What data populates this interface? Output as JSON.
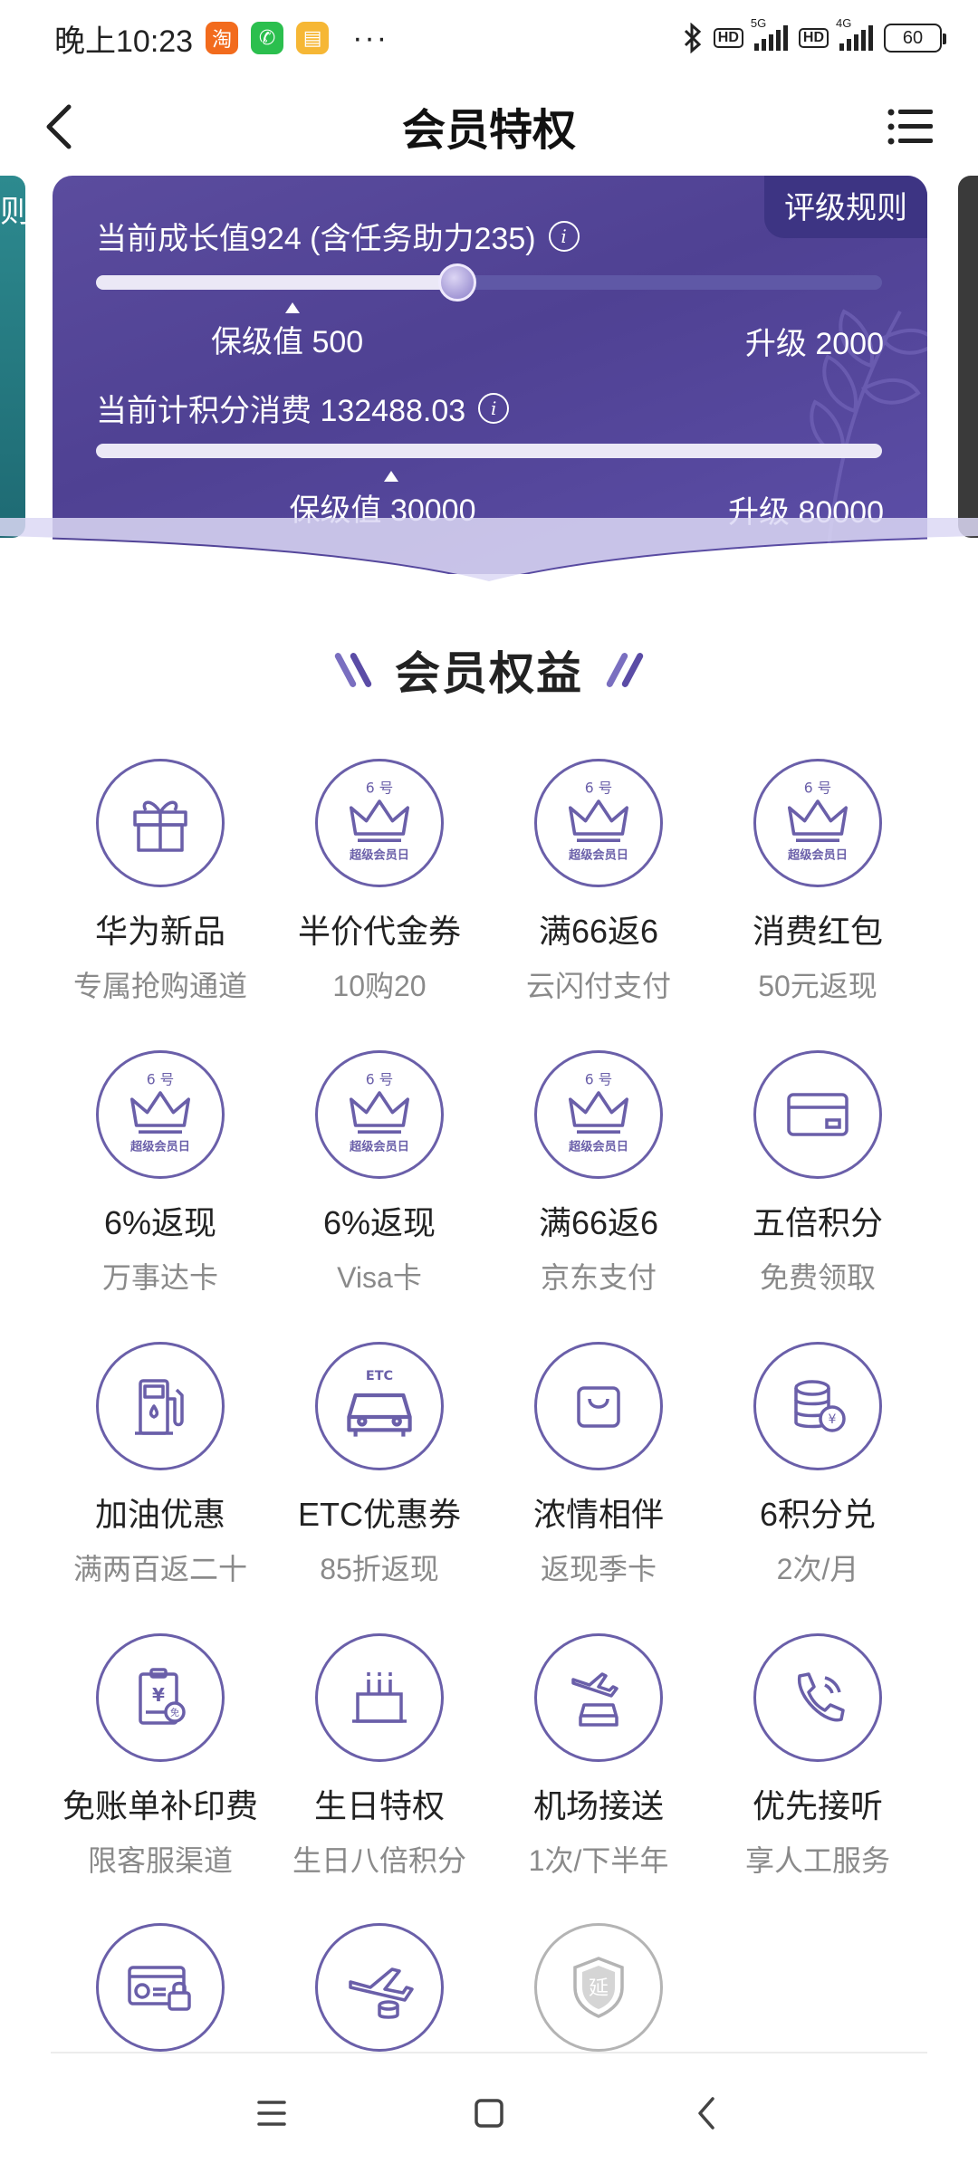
{
  "status_bar": {
    "time": "晚上10:23",
    "app_badges": [
      {
        "glyph": "淘",
        "color": "#f26b1d"
      },
      {
        "glyph": "✆",
        "color": "#2bbf4e"
      },
      {
        "glyph": "▤",
        "color": "#f6b735"
      }
    ],
    "more": "···",
    "hd1": "HD",
    "net1": "5G",
    "hd2": "HD",
    "net2": "4G",
    "battery": "60"
  },
  "header": {
    "title": "会员特权"
  },
  "banner": {
    "side_peek_text": "则",
    "rules_label": "评级规则",
    "growth": {
      "label": "当前成长值924 (含任务助力235)",
      "progress": 0.46,
      "keep_label": "保级值 500",
      "keep_pos": 0.25,
      "upgrade_label": "升级 2000"
    },
    "points": {
      "label": "当前计积分消费 132488.03",
      "progress": 1.0,
      "keep_label": "保级值 30000",
      "keep_pos": 0.375,
      "upgrade_label": "升级 80000"
    }
  },
  "section": {
    "title": "会员权益"
  },
  "benefits": [
    {
      "icon": "gift-icon",
      "name": "华为新品",
      "desc": "专属抢购通道"
    },
    {
      "icon": "super-member-day-icon",
      "name": "半价代金券",
      "desc": "10购20"
    },
    {
      "icon": "super-member-day-icon",
      "name": "满66返6",
      "desc": "云闪付支付"
    },
    {
      "icon": "super-member-day-icon",
      "name": "消费红包",
      "desc": "50元返现"
    },
    {
      "icon": "super-member-day-icon",
      "name": "6%返现",
      "desc": "万事达卡"
    },
    {
      "icon": "super-member-day-icon",
      "name": "6%返现",
      "desc": "Visa卡"
    },
    {
      "icon": "super-member-day-icon",
      "name": "满66返6",
      "desc": "京东支付"
    },
    {
      "icon": "card-icon",
      "name": "五倍积分",
      "desc": "免费领取"
    },
    {
      "icon": "fuel-pump-icon",
      "name": "加油优惠",
      "desc": "满两百返二十"
    },
    {
      "icon": "etc-car-icon",
      "name": "ETC优惠券",
      "desc": "85折返现"
    },
    {
      "icon": "shopping-bag-icon",
      "name": "浓情相伴",
      "desc": "返现季卡"
    },
    {
      "icon": "coin-stack-icon",
      "name": "6积分兑",
      "desc": "2次/月"
    },
    {
      "icon": "bill-clipboard-icon",
      "name": "免账单补印费",
      "desc": "限客服渠道"
    },
    {
      "icon": "birthday-cake-icon",
      "name": "生日特权",
      "desc": "生日八倍积分"
    },
    {
      "icon": "airport-car-icon",
      "name": "机场接送",
      "desc": "1次/下半年"
    },
    {
      "icon": "phone-icon",
      "name": "优先接听",
      "desc": "享人工服务"
    }
  ],
  "benefits_row5": [
    {
      "icon": "card-lock-icon"
    },
    {
      "icon": "plane-coins-icon"
    },
    {
      "icon": "shield-extend-icon",
      "glyph": "延"
    }
  ],
  "crown_icon": {
    "top_text": "6 号",
    "bottom_text": "超级会员日"
  },
  "etc_icon_text": "ETC",
  "colors": {
    "accent": "#6a5fa9",
    "banner": "#4f4193",
    "slash_left": "#7a6fc0",
    "slash_right": "#5b4ca6"
  }
}
